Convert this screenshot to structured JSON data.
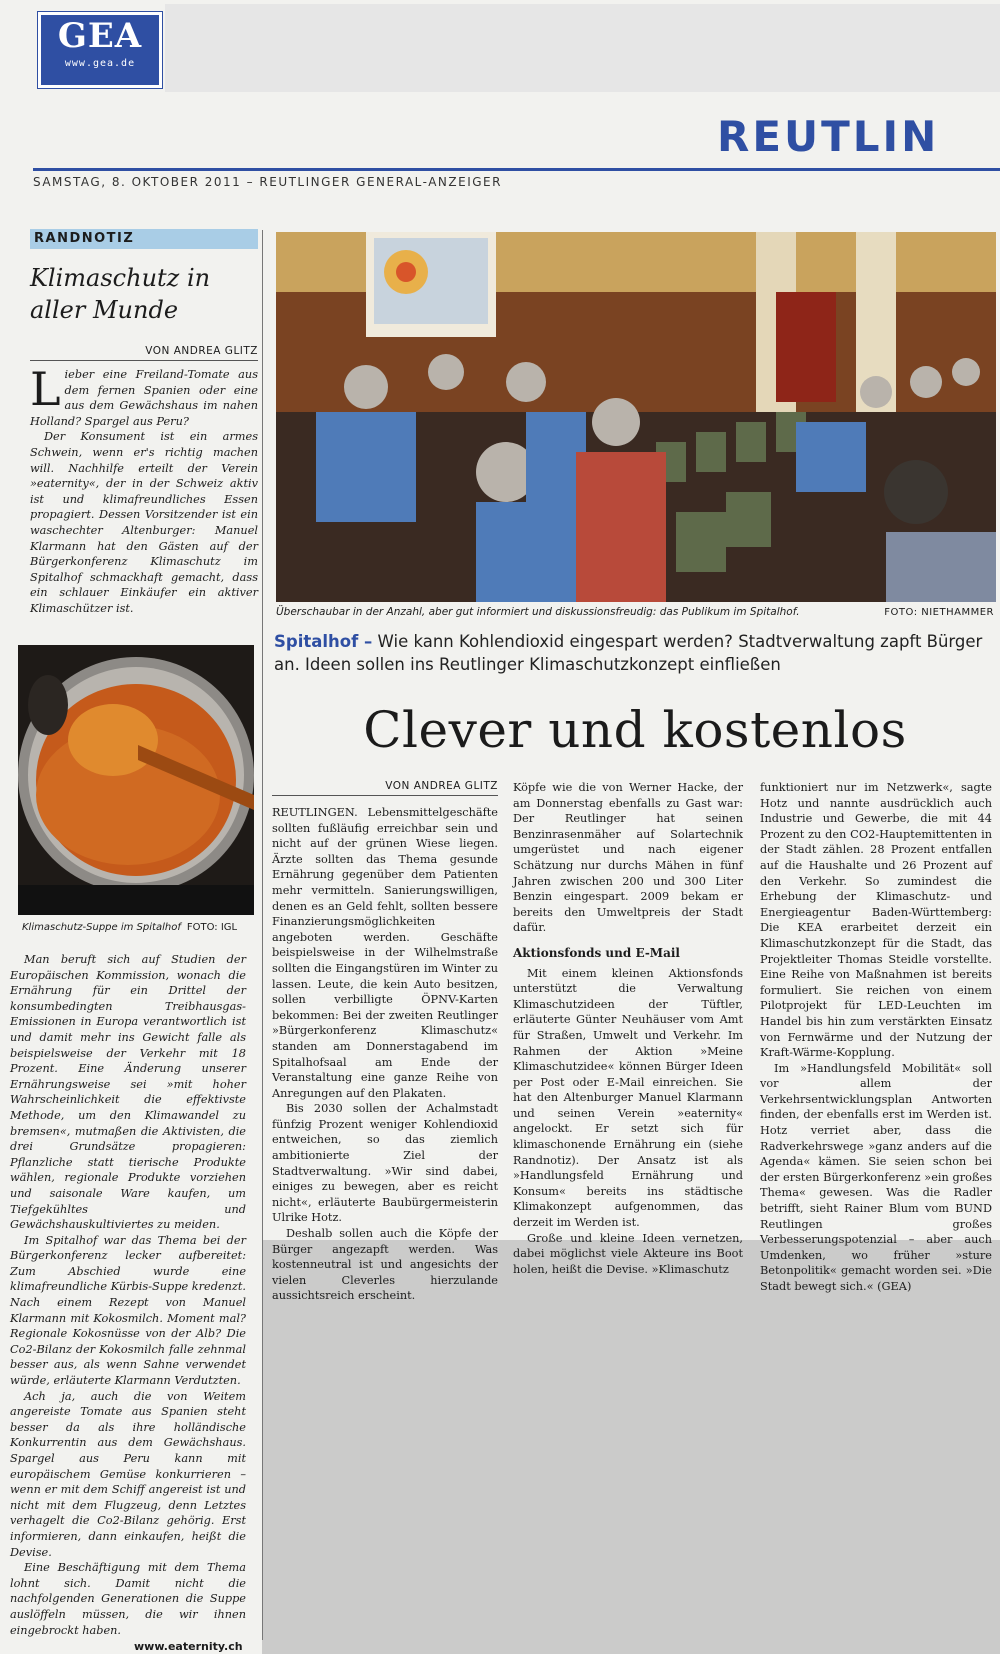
{
  "masthead": {
    "logo": "GEA",
    "logo_url": "www.gea.de",
    "section": "REUTLIN",
    "dateline": "SAMSTAG, 8. OKTOBER 2011 – REUTLINGER GENERAL-ANZEIGER"
  },
  "randnotiz": {
    "label": "RANDNOTIZ",
    "title_line1": "Klimaschutz in",
    "title_line2": "aller Munde",
    "byline": "VON ANDREA GLITZ",
    "dropcap": "L",
    "p1": "ieber eine Freiland-Tomate aus dem fernen Spanien oder eine aus dem Gewächshaus im nahen Holland? Spargel aus Peru?",
    "p2": "Der Konsument ist ein armes Schwein, wenn er's richtig machen will. Nachhilfe erteilt der Verein »eaternity«, der in der Schweiz aktiv ist und klimafreundliches Essen propagiert. Dessen Vorsitzender ist ein waschechter Altenburger: Manuel Klarmann hat den Gästen auf der Bürgerkonferenz Klimaschutz im Spitalhof schmackhaft gemacht, dass ein schlauer Einkäufer ein aktiver Klimaschützer ist.",
    "photo_caption": "Klimaschutz-Suppe im Spitalhof",
    "photo_credit": "FOTO: IGL",
    "p3": "Man beruft sich auf Studien der Europäischen Kommission, wonach die Ernährung für ein Drittel der konsumbedingten Treibhausgas-Emissionen in Europa verantwortlich ist und damit mehr ins Gewicht falle als beispielsweise der Verkehr mit 18 Prozent. Eine Änderung unserer Ernährungsweise sei »mit hoher Wahrscheinlichkeit die effektivste Methode, um den Klimawandel zu bremsen«, mutmaßen die Aktivisten, die drei Grundsätze propagieren: Pflanzliche statt tierische Produkte wählen, regionale Produkte vorziehen und saisonale Ware kaufen, um Tiefgekühltes und Gewächshauskultiviertes zu meiden.",
    "p4": "Im Spitalhof war das Thema bei der Bürgerkonferenz lecker aufbereitet: Zum Abschied wurde eine klimafreundliche Kürbis-Suppe kredenzt. Nach einem Rezept von Manuel Klarmann mit Kokosmilch. Moment mal? Regionale Kokosnüsse von der Alb? Die Co2-Bilanz der Kokosmilch falle zehnmal besser aus, als wenn Sahne verwendet würde, erläuterte Klarmann Verdutzten.",
    "p5": "Ach ja, auch die von Weitem angereiste Tomate aus Spanien steht besser da als ihre holländische Konkurrentin aus dem Gewächshaus. Spargel aus Peru kann mit europäischem Gemüse konkurrieren – wenn er mit dem Schiff angereist ist und nicht mit dem Flugzeug, denn Letztes verhagelt die Co2-Bilanz gehörig. Erst informieren, dann einkaufen, heißt die Devise.",
    "p6": "Eine Beschäftigung mit dem Thema lohnt sich. Damit nicht die nachfolgenden Generationen die Suppe auslöffeln müssen, die wir ihnen eingebrockt haben.",
    "url": "www.eaternity.ch"
  },
  "main": {
    "photo_caption": "Überschaubar in der Anzahl, aber gut informiert und diskussionsfreudig: das Publikum im Spitalhof.",
    "photo_credit": "FOTO: NIETHAMMER",
    "kicker_keyword": "Spitalhof –",
    "kicker_text": " Wie kann Kohlendioxid eingespart werden? Stadtverwaltung zapft Bürger an. Ideen sollen ins Reutlinger Klimaschutzkonzept einfließen",
    "headline": "Clever und kostenlos",
    "byline": "VON ANDREA GLITZ",
    "col1_p1": "REUTLINGEN. Lebensmittelgeschäfte sollten fußläufig erreichbar sein und nicht auf der grünen Wiese liegen. Ärzte sollten das Thema gesunde Ernährung gegenüber dem Patienten mehr vermitteln. Sanierungswilligen, denen es an Geld fehlt, sollten bessere Finanzierungsmöglichkeiten angeboten werden. Geschäfte beispielsweise in der Wilhelmstraße sollten die Eingangstüren im Winter zu lassen. Leute, die kein Auto besitzen, sollen verbilligte ÖPNV-Karten bekommen: Bei der zweiten Reutlinger »Bürgerkonferenz Klimaschutz« standen am Donnerstagabend im Spitalhofsaal am Ende der Veranstaltung eine ganze Reihe von Anregungen auf den Plakaten.",
    "col1_p2": "Bis 2030 sollen der Achalmstadt fünfzig Prozent weniger Kohlendioxid entweichen, so das ziemlich ambitionierte Ziel der Stadtverwaltung. »Wir sind dabei, einiges zu bewegen, aber es reicht nicht«, erläuterte Baubürgermeisterin Ulrike Hotz.",
    "col1_p3": "Deshalb sollen auch die Köpfe der Bürger angezapft werden. Was kostenneutral ist und angesichts der vielen Cleverles hierzulande aussichtsreich erscheint.",
    "col2_p1": "Köpfe wie die von Werner Hacke, der am Donnerstag ebenfalls zu Gast war: Der Reutlinger hat seinen Benzinrasenmäher auf Solartechnik umgerüstet und nach eigener Schätzung nur durchs Mähen in fünf Jahren zwischen 200 und 300 Liter Benzin eingespart. 2009 bekam er bereits den Umweltpreis der Stadt dafür.",
    "col2_subhead": "Aktionsfonds und E-Mail",
    "col2_p2": "Mit einem kleinen Aktionsfonds unterstützt die Verwaltung Klimaschutzideen der Tüftler, erläuterte Günter Neuhäuser vom Amt für Straßen, Umwelt und Verkehr. Im Rahmen der Aktion »Meine Klimaschutzidee« können Bürger Ideen per Post oder E-Mail einreichen. Sie hat den Altenburger Manuel Klarmann und seinen Verein »eaternity« angelockt. Er setzt sich für klimaschonende Ernährung ein (siehe Randnotiz). Der Ansatz ist als »Handlungsfeld Ernährung und Konsum« bereits ins städtische Klimakonzept aufgenommen, das derzeit im Werden ist.",
    "col2_p3": "Große und kleine Ideen vernetzen, dabei möglichst viele Akteure ins Boot holen, heißt die Devise. »Klimaschutz",
    "col3_p1": "funktioniert nur im Netzwerk«, sagte Hotz und nannte ausdrücklich auch Industrie und Gewerbe, die mit 44 Prozent zu den CO2-Hauptemittenten in der Stadt zählen. 28 Prozent entfallen auf die Haushalte und 26 Prozent auf den Verkehr. So zumindest die Erhebung der Klimaschutz- und Energieagentur Baden-Württemberg: Die KEA erarbeitet derzeit ein Klimaschutzkonzept für die Stadt, das Projektleiter Thomas Steidle vorstellte. Eine Reihe von Maßnahmen ist bereits formuliert. Sie reichen von einem Pilotprojekt für LED-Leuchten im Handel bis hin zum verstärkten Einsatz von Fernwärme und der Nutzung der Kraft-Wärme-Kopplung.",
    "col3_p2": "Im »Handlungsfeld Mobilität« soll vor allem der Verkehrsentwicklungsplan Antworten finden, der ebenfalls erst im Werden ist. Hotz verriet aber, dass die Radverkehrswege »ganz anders auf die Agenda« kämen. Sie seien schon bei der ersten Bürgerkonferenz »ein großes Thema« gewesen. Was die Radler betrifft, sieht Rainer Blum vom BUND Reutlingen großes Verbesserungspotenzial – aber auch Umdenken, wo früher »sture Betonpolitik« gemacht worden sei. »Die Stadt bewegt sich.« (GEA)"
  },
  "colors": {
    "brand_blue": "#2f4fa3",
    "randnotiz_bg": "#a9cde6"
  }
}
